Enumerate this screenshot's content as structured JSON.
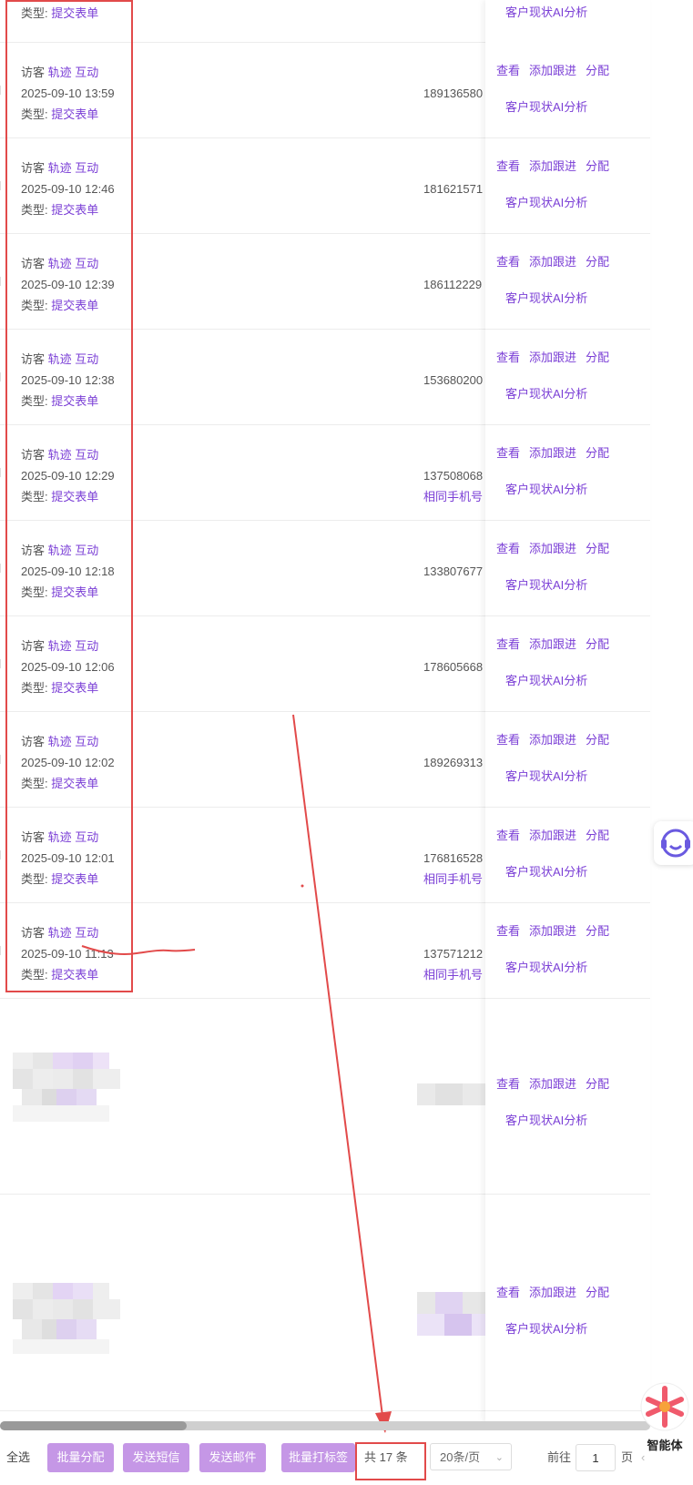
{
  "type_label": "类型:",
  "visitor_label": "访客",
  "track_link": "轨迹",
  "interact_link": "互动",
  "type_value": "提交表单",
  "top_partial": {
    "type_label": "类型:",
    "type_value": "提交表单",
    "ai_link": "客户现状AI分析"
  },
  "rows": [
    {
      "datetime": "2025-09-10 13:59",
      "phone": "189136580",
      "same_phone": ""
    },
    {
      "datetime": "2025-09-10 12:46",
      "phone": "181621571",
      "same_phone": ""
    },
    {
      "datetime": "2025-09-10 12:39",
      "phone": "186112229",
      "same_phone": ""
    },
    {
      "datetime": "2025-09-10 12:38",
      "phone": "153680200",
      "same_phone": ""
    },
    {
      "datetime": "2025-09-10 12:29",
      "phone": "137508068",
      "same_phone": "相同手机号"
    },
    {
      "datetime": "2025-09-10 12:18",
      "phone": "133807677",
      "same_phone": ""
    },
    {
      "datetime": "2025-09-10 12:06",
      "phone": "178605668",
      "same_phone": ""
    },
    {
      "datetime": "2025-09-10 12:02",
      "phone": "189269313",
      "same_phone": ""
    },
    {
      "datetime": "2025-09-10 12:01",
      "phone": "176816528",
      "same_phone": "相同手机号"
    },
    {
      "datetime": "2025-09-10 11:13",
      "phone": "137571212",
      "same_phone": "相同手机号"
    }
  ],
  "actions": {
    "view": "查看",
    "add_follow": "添加跟进",
    "assign": "分配",
    "ai_analysis": "客户现状AI分析"
  },
  "footer": {
    "select_all": "全选",
    "batch_assign": "批量分配",
    "send_sms": "发送短信",
    "send_email": "发送邮件",
    "batch_tag": "批量打标签",
    "total": "共 17 条",
    "page_size": "20条/页",
    "goto_label": "前往",
    "page_value": "1",
    "page_unit": "页"
  },
  "agent_label": "智能体",
  "colors": {
    "accent": "#7b3fd6",
    "button": "#c597e6",
    "annotation": "#e24a4a"
  }
}
